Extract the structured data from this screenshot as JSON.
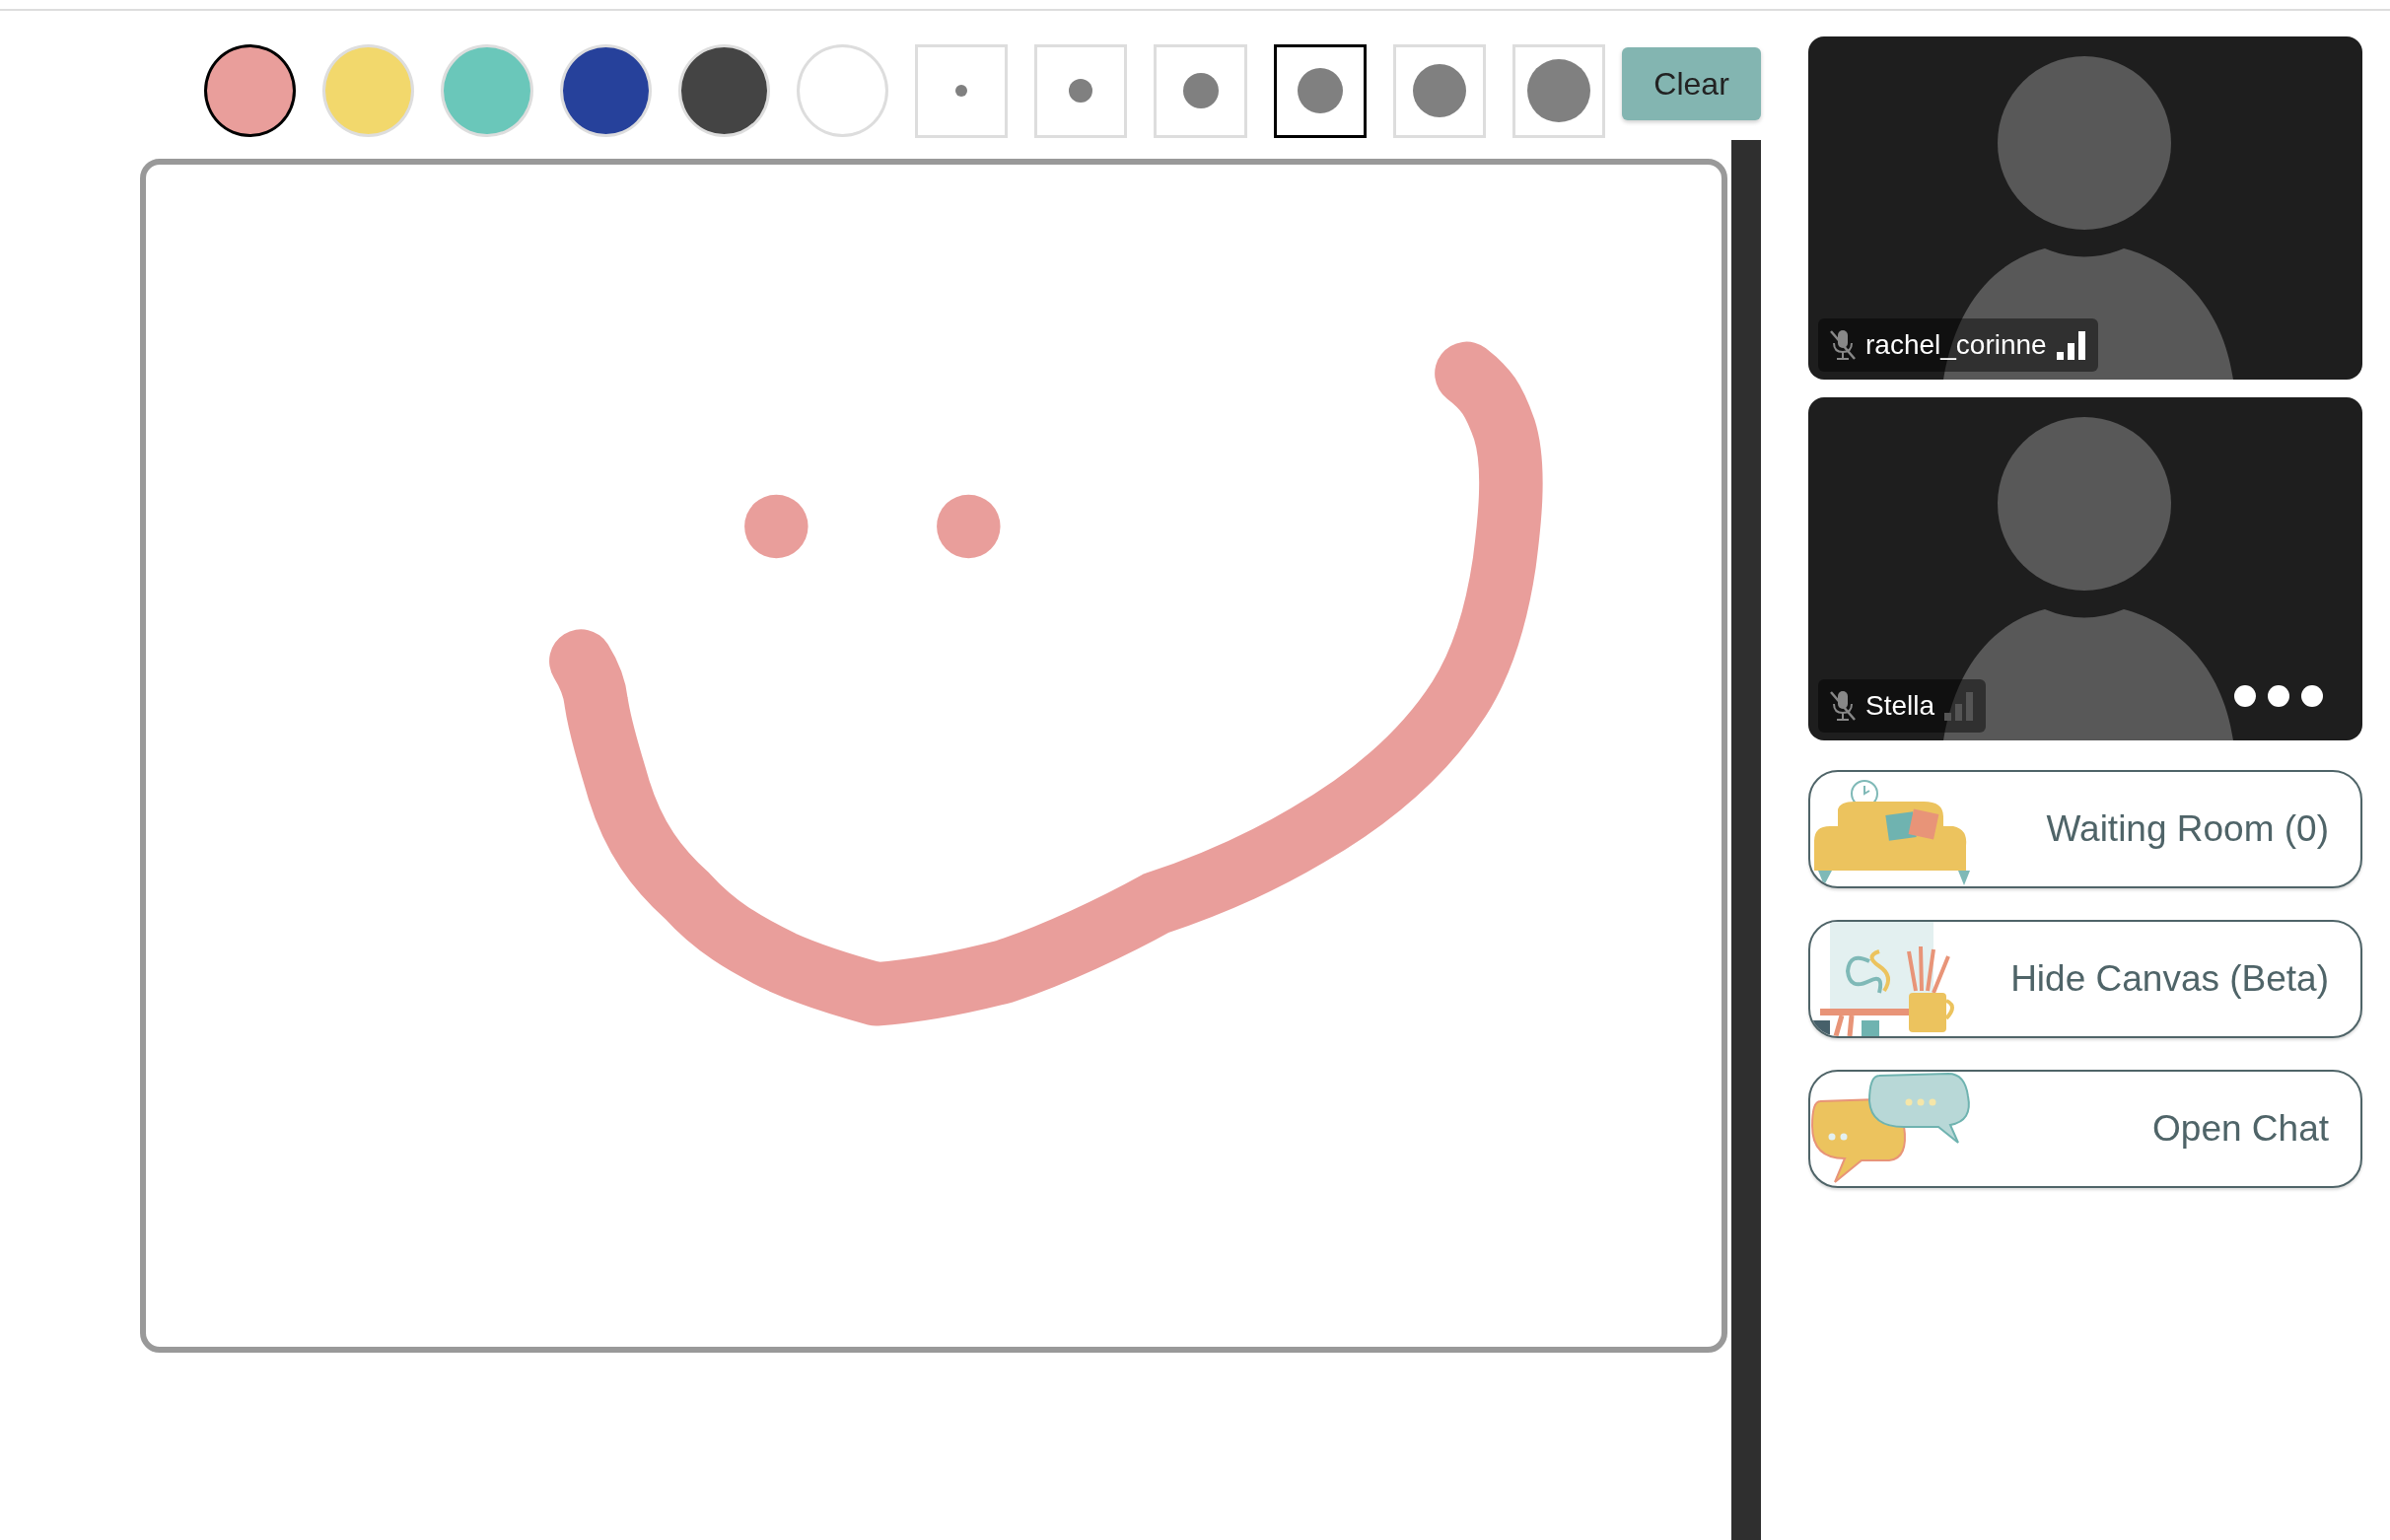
{
  "palette": [
    {
      "color": "#e99e9b",
      "selected": true
    },
    {
      "color": "#f2d86c",
      "selected": false
    },
    {
      "color": "#6ac7ba",
      "selected": false
    },
    {
      "color": "#26419b",
      "selected": false
    },
    {
      "color": "#444444",
      "selected": false
    },
    {
      "color": "#ffffff",
      "selected": false
    }
  ],
  "brush_sizes": [
    {
      "selected": false
    },
    {
      "selected": false
    },
    {
      "selected": false
    },
    {
      "selected": true
    },
    {
      "selected": false
    },
    {
      "selected": false
    }
  ],
  "clear_button": "Clear",
  "participants": [
    {
      "name": "rachel_corinne",
      "muted": true,
      "weak_signal": false,
      "show_menu": false
    },
    {
      "name": "Stella",
      "muted": true,
      "weak_signal": true,
      "show_menu": true
    }
  ],
  "actions": [
    {
      "label": "Waiting Room (0)",
      "kind": "sofa"
    },
    {
      "label": "Hide Canvas (Beta)",
      "kind": "easel"
    },
    {
      "label": "Open Chat",
      "kind": "chat"
    }
  ]
}
